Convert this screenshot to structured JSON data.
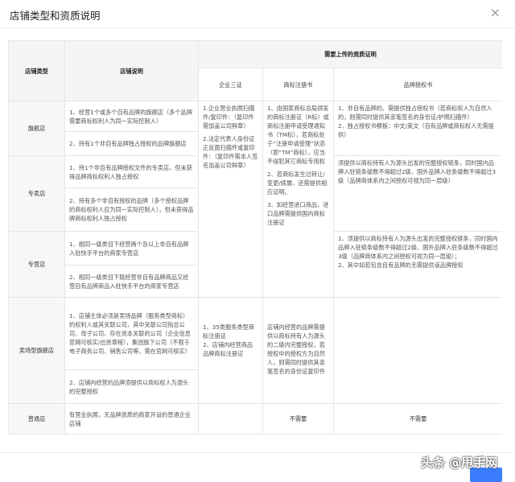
{
  "dialog": {
    "title": "店铺类型和资质说明",
    "close_glyph": "×"
  },
  "table": {
    "header": {
      "col_type": "店铺类型",
      "col_desc": "店铺说明",
      "group": "需要上传的资质证明",
      "sub_cols": [
        "企业三证",
        "商标注册书",
        "品牌授权书"
      ]
    },
    "rows": {
      "flagship": {
        "type": "旗舰店",
        "desc": [
          "1、经营1个或多个自有品牌的旗舰店（多个品牌需要商标权利人为同一实际控制人）",
          "2、持有1个非自有品牌独占授权的品牌旗舰店"
        ]
      },
      "exclusive": {
        "type": "专卖店",
        "desc": [
          "1、持1个非自有品牌授权文件的专卖店，但未获得品牌商标权利人独占授权",
          "2、持有多个非自有授权的品牌（多个授权品牌的商标权利人应为同一实际控制人），但未获得品牌商标权利人独占授权"
        ]
      },
      "specialty": {
        "type": "专营店",
        "desc": [
          "1、相同一级类目下经营两个及以上非自有品牌入驻快手平台的商家专营店",
          "2、相同一级类目下既经营非自有品牌商品又经营自有品牌商品入驻快手平台的商家专营店"
        ]
      },
      "mall_flagship": {
        "type": "卖场型旗舰店",
        "desc": [
          "1、店铺主体必须是卖场品牌（服务类型商标）的权利人或其关联公司，其中关联公司指总公司、母子公司、存在资本关联的公司（企业信息官网可核实/出资章程），集团旗下公司（不限于电子商务公司、销售公司等，需在官网可核实）",
          "2、店铺内经营的品牌须提供以商标权人为源头的完整授权"
        ]
      },
      "general": {
        "type": "普通店",
        "desc": "有营业执照，无品牌资质的商家开设的普通企业店铺"
      }
    },
    "requirements": {
      "enterprise_certs": [
        "1.企业营业执照扫描件/复印件：（复印件需加盖公司鲜章）",
        "2.法定代表人身份证正反面扫描件或复印件：（复印件需本人签名加盖公司鲜章）"
      ],
      "trademark_main": [
        "1、由国家商标总局颁发的商标注册证（R标）或商标注册申请受理通知书（TM标），若商标处于“注册申请受理”状态（即“TM”商标），应当不侵犯其它商标专用权",
        "2、若商标发生过转让/变更/续展，还需提供相应证明。",
        "3、如经营进口商品，进口品牌需提供国内商标注册证"
      ],
      "trademark_mall": [
        "1、35类服务类型商标注册证",
        "2、店铺内经营商品品牌商标注册证"
      ],
      "auth_flagship": [
        "1、非自有品牌的，需提供独占授权书（若商标权人为自然人的，则需同时提供其亲笔签名的身份证/护照扫描件）",
        "2、独占授权书模板：中文/英文（自有品牌或商标权人无需提供）"
      ],
      "auth_exclusive": "须提供以商标持有人为源头出发的完整授权链条，同时国内品牌入驻链条级数不得超过2级，国外品牌入驻条级数不得超过3级（品牌商体系内之间授权可视为同一层级）",
      "auth_specialty": [
        "1、须提供以商标持有人为源头出发的完整授权链条，同时国内品牌入驻链条级数不得超过2级、国外品牌入驻条级数不得超过3级（品牌商体系内之间授权可视为同一层级）；",
        "2、其中如若包含自有品牌的无需提供该品牌授权"
      ],
      "auth_mall": "店铺内经营的品牌需提供以商标持有人为源头的二级内完整授权，若授权中的授权方为自然人，则需同时提供其亲笔签名的身份证复印件",
      "not_required": "不需要"
    }
  },
  "watermark": "头条 @甩手网",
  "colors": {
    "primary_button": "#3b7cff",
    "type_cell_bg": "#f7f7f7"
  }
}
